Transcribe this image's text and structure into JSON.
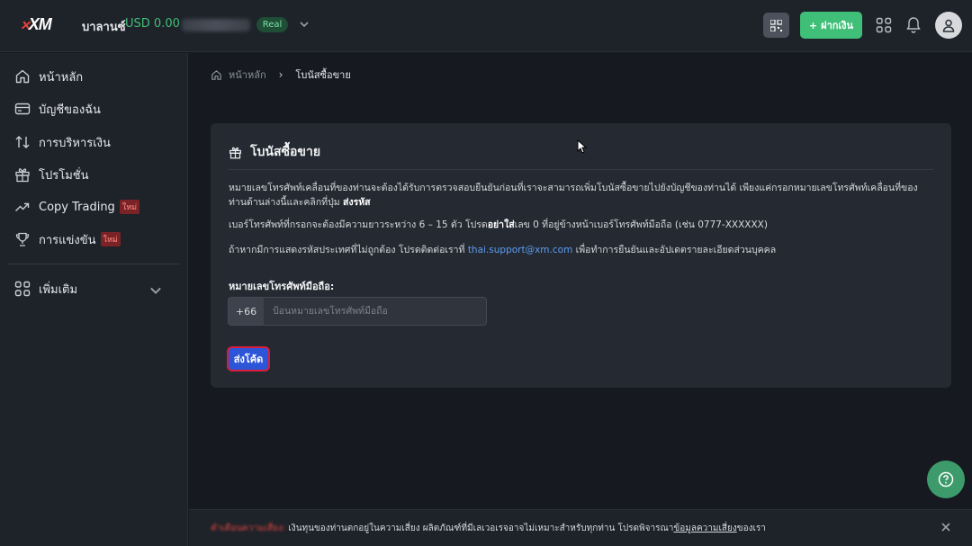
{
  "header": {
    "logo": "XM",
    "balance_label": "บาลานซ์",
    "balance_value": "USD 0.00",
    "account_badge": "Real",
    "deposit_label": "ฝากเงิน"
  },
  "sidebar": {
    "items": [
      {
        "label": "หน้าหลัก",
        "icon": "home-icon"
      },
      {
        "label": "บัญชีของฉัน",
        "icon": "card-icon"
      },
      {
        "label": "การบริหารเงิน",
        "icon": "transfer-icon"
      },
      {
        "label": "โปรโมชั่น",
        "icon": "gift-icon"
      },
      {
        "label": "Copy Trading",
        "icon": "trend-icon",
        "badge": "ใหม่"
      },
      {
        "label": "การแข่งขัน",
        "icon": "trophy-icon",
        "badge": "ใหม่"
      }
    ],
    "more_label": "เพิ่มเติม"
  },
  "breadcrumb": {
    "home": "หน้าหลัก",
    "current": "โบนัสซื้อขาย"
  },
  "card": {
    "title": "โบนัสซื้อขาย",
    "para1": "หมายเลขโทรศัพท์เคลื่อนที่ของท่านจะต้องได้รับการตรวจสอบยืนยันก่อนที่เราจะสามารถเพิ่มโบนัสซื้อขายไปยังบัญชีของท่านได้ เพียงแค่กรอกหมายเลขโทรศัพท์เคลื่อนที่ของท่านด้านล่างนี้และคลิกที่ปุ่ม",
    "para1_bold": "ส่งรหัส",
    "para2_a": "เบอร์โทรศัพท์ที่กรอกจะต้องมีความยาวระหว่าง 6 – 15 ตัว โปรด",
    "para2_bold": "อย่าใส่",
    "para2_b": "เลข 0 ที่อยู่ข้างหน้าเบอร์โทรศัพท์มือถือ (เช่น 0777-XXXXXX)",
    "para3_a": "ถ้าหากมีการแสดงรหัสประเทศที่ไม่ถูกต้อง โปรดติดต่อเราที่",
    "para3_email": "thai.support@xm.com",
    "para3_b": "เพื่อทำการยืนยันและอัปเดตรายละเอียดส่วนบุคคล",
    "field_label": "หมายเลขโทรศัพท์มือถือ:",
    "phone_prefix": "+66",
    "phone_placeholder": "ป้อนหมายเลขโทรศัพท์มือถือ",
    "phone_value": "",
    "send_label": "ส่งโค้ด"
  },
  "risk": {
    "label": "คำเตือนความเสี่ยง:",
    "text": "เงินทุนของท่านตกอยู่ในความเสี่ยง ผลิตภัณฑ์ที่มีเลเวอเรจอาจไม่เหมาะสำหรับทุกท่าน โปรดพิจารณา",
    "link": "ข้อมูลความเสี่ยง",
    "suffix": "ของเรา"
  },
  "colors": {
    "accent_green": "#3fbf77",
    "primary_blue": "#2d55d8",
    "badge_red": "#7a2326"
  }
}
